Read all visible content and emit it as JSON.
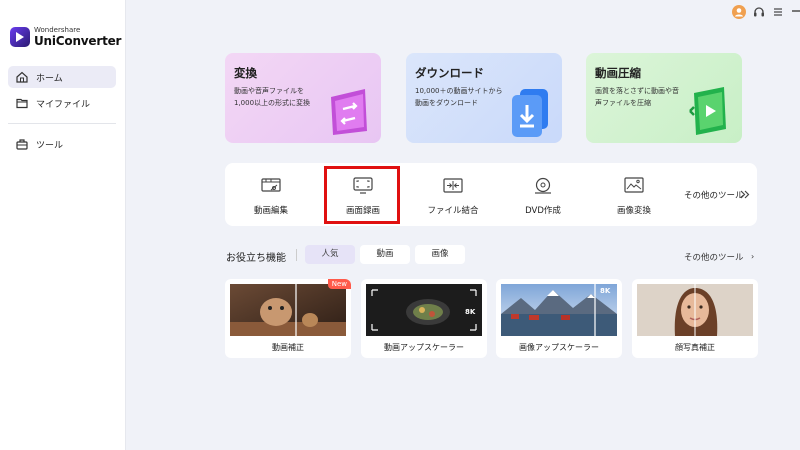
{
  "app": {
    "brand_small": "Wondershare",
    "brand_name": "UniConverter"
  },
  "sidebar": {
    "items": [
      {
        "label": "ホーム",
        "icon": "home-icon",
        "active": true
      },
      {
        "label": "マイファイル",
        "icon": "folder-icon",
        "active": false
      },
      {
        "label": "ツール",
        "icon": "toolbox-icon",
        "active": false
      }
    ]
  },
  "header": {
    "avatar_initial": "",
    "icons": [
      "avatar",
      "headset-icon",
      "menu-icon",
      "minimize-icon"
    ]
  },
  "feature_cards": [
    {
      "title": "変換",
      "desc": "動画や音声ファイルを1,000以上の形式に変換",
      "color": "#f0d3f4",
      "icon": "convert-art-icon"
    },
    {
      "title": "ダウンロード",
      "desc": "10,000＋の動画サイトから動画をダウンロード",
      "color": "#d6e2fb",
      "icon": "download-art-icon"
    },
    {
      "title": "動画圧縮",
      "desc": "画質を落とさずに動画や音声ファイルを圧縮",
      "color": "#d5f3d2",
      "icon": "compress-art-icon"
    }
  ],
  "tools": [
    {
      "label": "動画編集",
      "icon": "video-edit-icon"
    },
    {
      "label": "画面録画",
      "icon": "screen-record-icon",
      "highlighted": true
    },
    {
      "label": "ファイル結合",
      "icon": "merge-icon"
    },
    {
      "label": "DVD作成",
      "icon": "dvd-icon"
    },
    {
      "label": "画像変換",
      "icon": "image-convert-icon"
    }
  ],
  "tools_more_label": "その他のツール",
  "useful": {
    "title": "お役立ち機能",
    "tabs": [
      {
        "label": "人気",
        "active": true
      },
      {
        "label": "動画",
        "active": false
      },
      {
        "label": "画像",
        "active": false
      }
    ],
    "more_label": "その他のツール",
    "more_arrow": "›",
    "cards": [
      {
        "label": "動画補正",
        "badge": "New"
      },
      {
        "label": "動画アップスケーラー",
        "badge": ""
      },
      {
        "label": "画像アップスケーラー",
        "badge": ""
      },
      {
        "label": "顔写真補正",
        "badge": ""
      }
    ],
    "upscale_label": "8K"
  },
  "colors": {
    "accent": "#6a3df0",
    "highlight_border": "#e01010",
    "new_badge": "#ff5a4a"
  }
}
